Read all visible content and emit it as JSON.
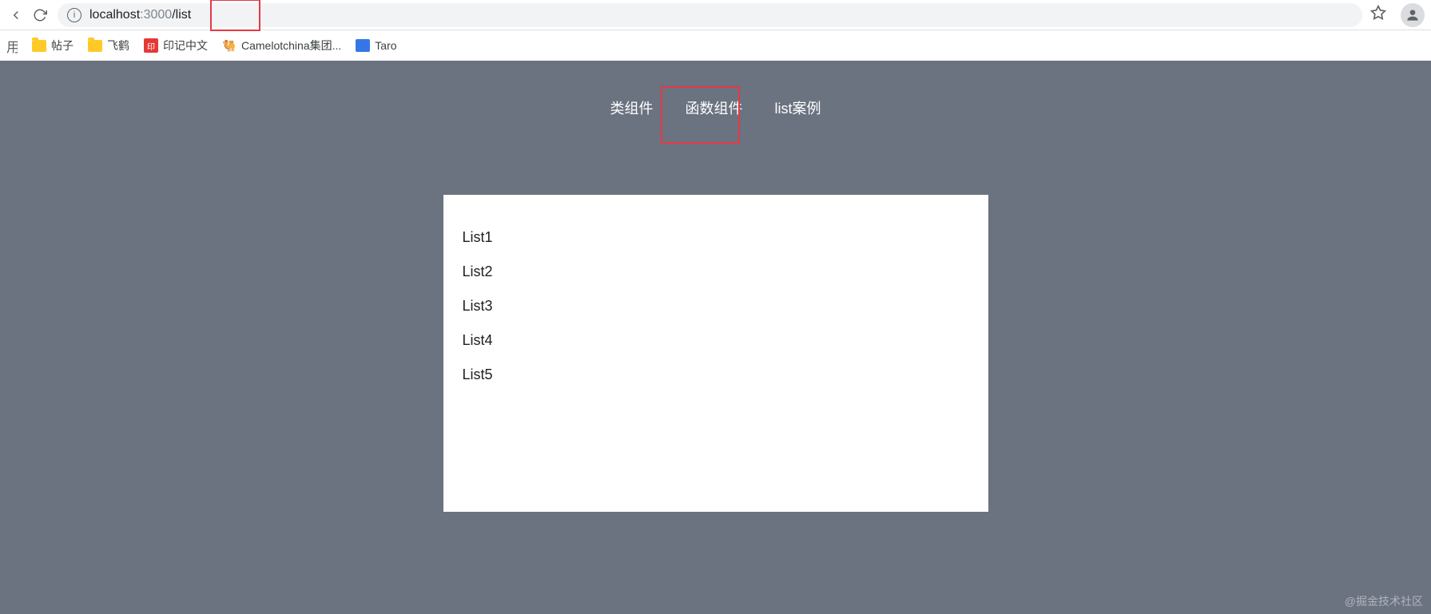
{
  "browser": {
    "url_host": "localhost",
    "url_port": ":3000",
    "url_path": "/list"
  },
  "bookmarks": {
    "apps_label": "用",
    "items": [
      {
        "label": "帖子",
        "icon": "folder"
      },
      {
        "label": "飞鹤",
        "icon": "folder"
      },
      {
        "label": "印记中文",
        "icon": "red"
      },
      {
        "label": "Camelotchina集团...",
        "icon": "camelot"
      },
      {
        "label": "Taro",
        "icon": "taro"
      }
    ]
  },
  "nav": {
    "tabs": [
      {
        "label": "类组件"
      },
      {
        "label": "函数组件"
      },
      {
        "label": "list案例"
      }
    ]
  },
  "list": {
    "items": [
      "List1",
      "List2",
      "List3",
      "List4",
      "List5"
    ]
  },
  "watermark": "@掘金技术社区"
}
